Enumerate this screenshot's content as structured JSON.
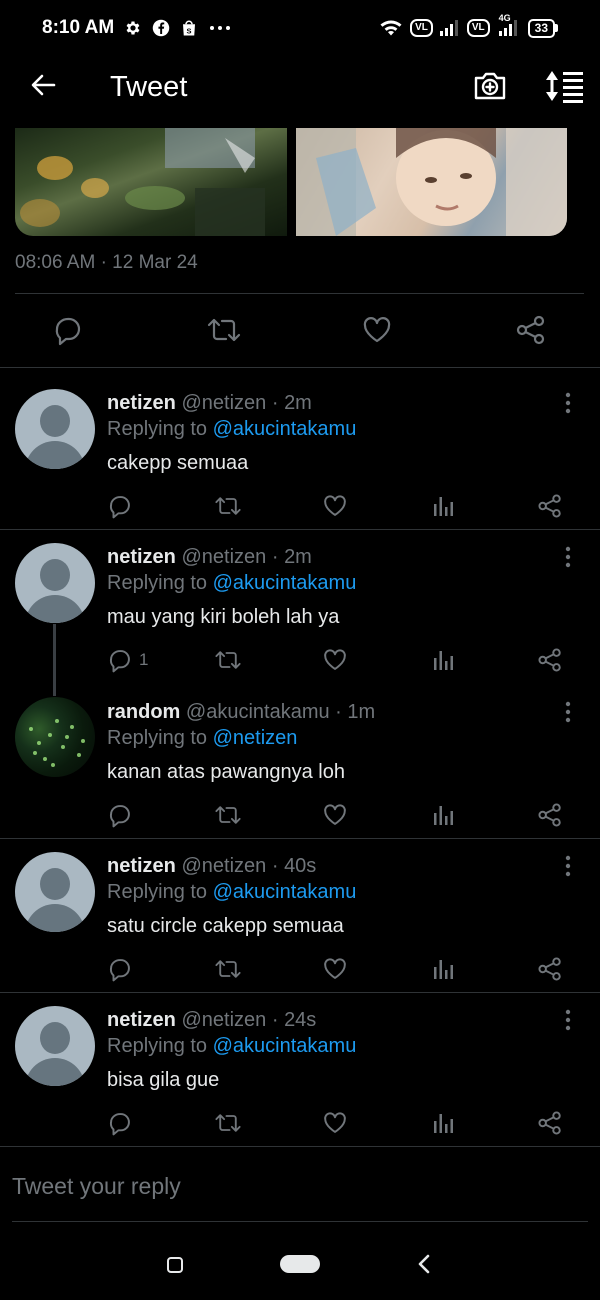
{
  "status_bar": {
    "time": "8:10 AM",
    "icons": [
      "gear-icon",
      "facebook-icon",
      "shopping-bag-icon",
      "more-dots-icon"
    ],
    "right_icons": [
      "wifi-icon",
      "volte-icon",
      "signal-icon",
      "volte-icon",
      "4g-signal-icon"
    ],
    "vl_label": "VL",
    "network_label": "4G",
    "battery": "33"
  },
  "header": {
    "title": "Tweet",
    "back_icon": "back-arrow-icon",
    "camera_icon": "camera-add-icon",
    "sort_icon": "sort-icon"
  },
  "tweet": {
    "timestamp": "08:06 AM",
    "date": "12 Mar 24",
    "separator": "·",
    "actions": [
      "reply-icon",
      "retweet-icon",
      "like-icon",
      "share-icon"
    ]
  },
  "replies": [
    {
      "name": "netizen",
      "handle": "@netizen",
      "time": "2m",
      "replying_prefix": "Replying to",
      "replying_to": "@akucintakamu",
      "text": "cakepp semuaa",
      "reply_count": "",
      "avatar": "default-avatar"
    },
    {
      "name": "netizen",
      "handle": "@netizen",
      "time": "2m",
      "replying_prefix": "Replying to",
      "replying_to": "@akucintakamu",
      "text": "mau yang kiri boleh lah ya",
      "reply_count": "1",
      "avatar": "default-avatar"
    },
    {
      "name": "random",
      "handle": "@akucintakamu",
      "time": "1m",
      "replying_prefix": "Replying to",
      "replying_to": "@netizen",
      "text": "kanan atas pawangnya loh",
      "reply_count": "",
      "avatar": "photo-avatar"
    },
    {
      "name": "netizen",
      "handle": "@netizen",
      "time": "40s",
      "replying_prefix": "Replying to",
      "replying_to": "@akucintakamu",
      "text": "satu circle cakepp semuaa",
      "reply_count": "",
      "avatar": "default-avatar"
    },
    {
      "name": "netizen",
      "handle": "@netizen",
      "time": "24s",
      "replying_prefix": "Replying to",
      "replying_to": "@akucintakamu",
      "text": "bisa gila gue",
      "reply_count": "",
      "avatar": "default-avatar"
    }
  ],
  "composer": {
    "placeholder": "Tweet your reply"
  },
  "colors": {
    "background": "#000000",
    "text": "#e7e9ea",
    "secondary": "#71767b",
    "accent": "#1d9bf0",
    "divider": "#2f3336"
  }
}
